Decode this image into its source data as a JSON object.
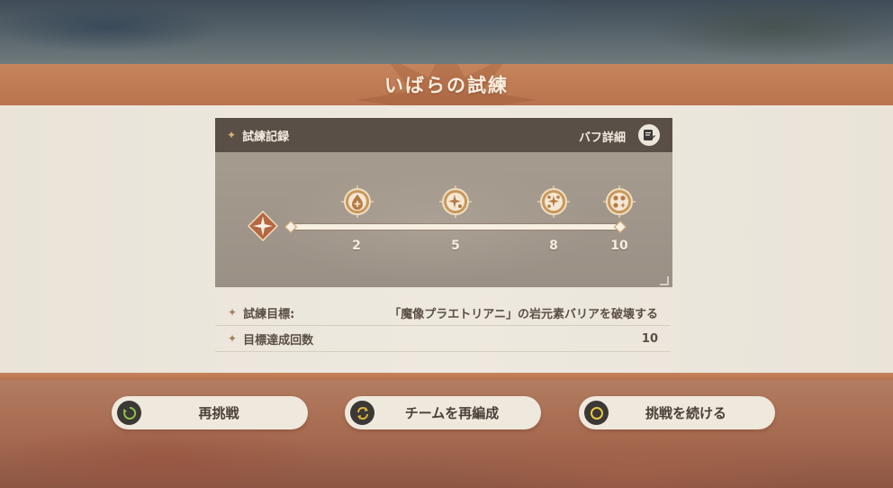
{
  "screen": {
    "title": "いばらの試練"
  },
  "record": {
    "title": "試練記録",
    "buff_detail_label": "バフ詳細",
    "milestones": [
      {
        "value": "2",
        "icon": "healing-drop-icon"
      },
      {
        "value": "5",
        "icon": "star-spark-icon"
      },
      {
        "value": "8",
        "icon": "cluster-spark-icon"
      },
      {
        "value": "10",
        "icon": "multi-orb-icon"
      }
    ]
  },
  "info": {
    "objective_label": "試練目標:",
    "objective_value": "「魔像プラエトリアニ」の岩元素バリアを破壊する",
    "count_label": "目標達成回数",
    "count_value": "10"
  },
  "buttons": {
    "retry": "再挑戦",
    "reform_team": "チームを再編成",
    "continue": "挑戦を続ける"
  },
  "colors": {
    "title_bar": "#c6845c",
    "panel": "#eee9df",
    "record_header": "#5a4f47",
    "record_body": "#9d9387",
    "retry_icon_ring": "#8fc34a",
    "reform_icon_ring": "#e0b33a",
    "continue_icon_ring": "#e8c640"
  }
}
